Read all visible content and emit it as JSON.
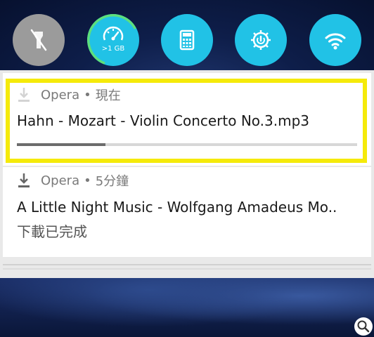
{
  "quick_settings": {
    "flashlight": {
      "icon": "flashlight-off-icon",
      "state": "off"
    },
    "data_usage": {
      "icon": "speedometer-icon",
      "label": ">1 GB",
      "ring_fraction": 0.62
    },
    "calculator": {
      "icon": "calculator-icon",
      "state": "on"
    },
    "power_saving": {
      "icon": "gear-power-icon",
      "state": "on"
    },
    "wifi": {
      "icon": "wifi-icon",
      "state": "on"
    }
  },
  "notifications": [
    {
      "app": "Opera",
      "separator": "•",
      "time": "現在",
      "title": "Hahn - Mozart - Violin Concerto No.3.mp3",
      "progress": 0.26,
      "icon": "download-icon"
    },
    {
      "app": "Opera",
      "separator": "•",
      "time": "5分鐘",
      "title": "A Little Night Music - Wolfgang Amadeus Mo..",
      "status": "下載已完成",
      "icon": "download-icon"
    }
  ],
  "colors": {
    "accent": "#21c2e6",
    "toggle_off": "#9b9b9b",
    "highlight": "#f5ea0a",
    "data_ring": "#5ee07a"
  }
}
